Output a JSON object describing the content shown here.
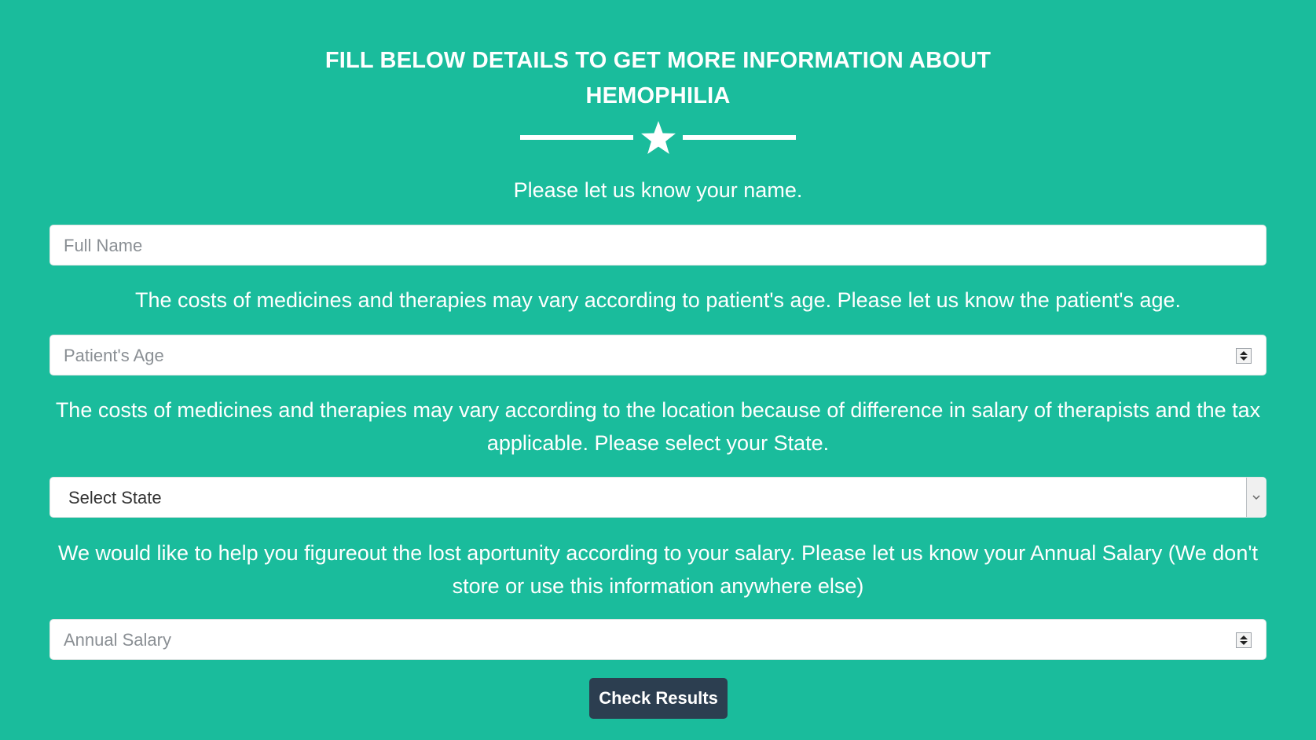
{
  "heading": {
    "line1": "FILL BELOW DETAILS TO GET MORE INFORMATION ABOUT",
    "line2": "HEMOPHILIA"
  },
  "colors": {
    "background": "#1abc9c",
    "button": "#2c3e50",
    "text": "#ffffff"
  },
  "divider_icon": "star-icon",
  "name_section": {
    "prompt": "Please let us know your name.",
    "placeholder": "Full Name"
  },
  "age_section": {
    "prompt": "The costs of medicines and therapies may vary according to patient's age. Please let us know the patient's age.",
    "placeholder": "Patient's Age"
  },
  "state_section": {
    "prompt": "The costs of medicines and therapies may vary according to the location because of difference in salary of therapists and the tax applicable. Please select your State.",
    "selected": "Select State"
  },
  "salary_section": {
    "prompt": "We would like to help you figureout the lost aportunity according to your salary. Please let us know your Annual Salary (We don't store or use this information anywhere else)",
    "placeholder": "Annual Salary"
  },
  "submit": {
    "label": "Check Results"
  }
}
